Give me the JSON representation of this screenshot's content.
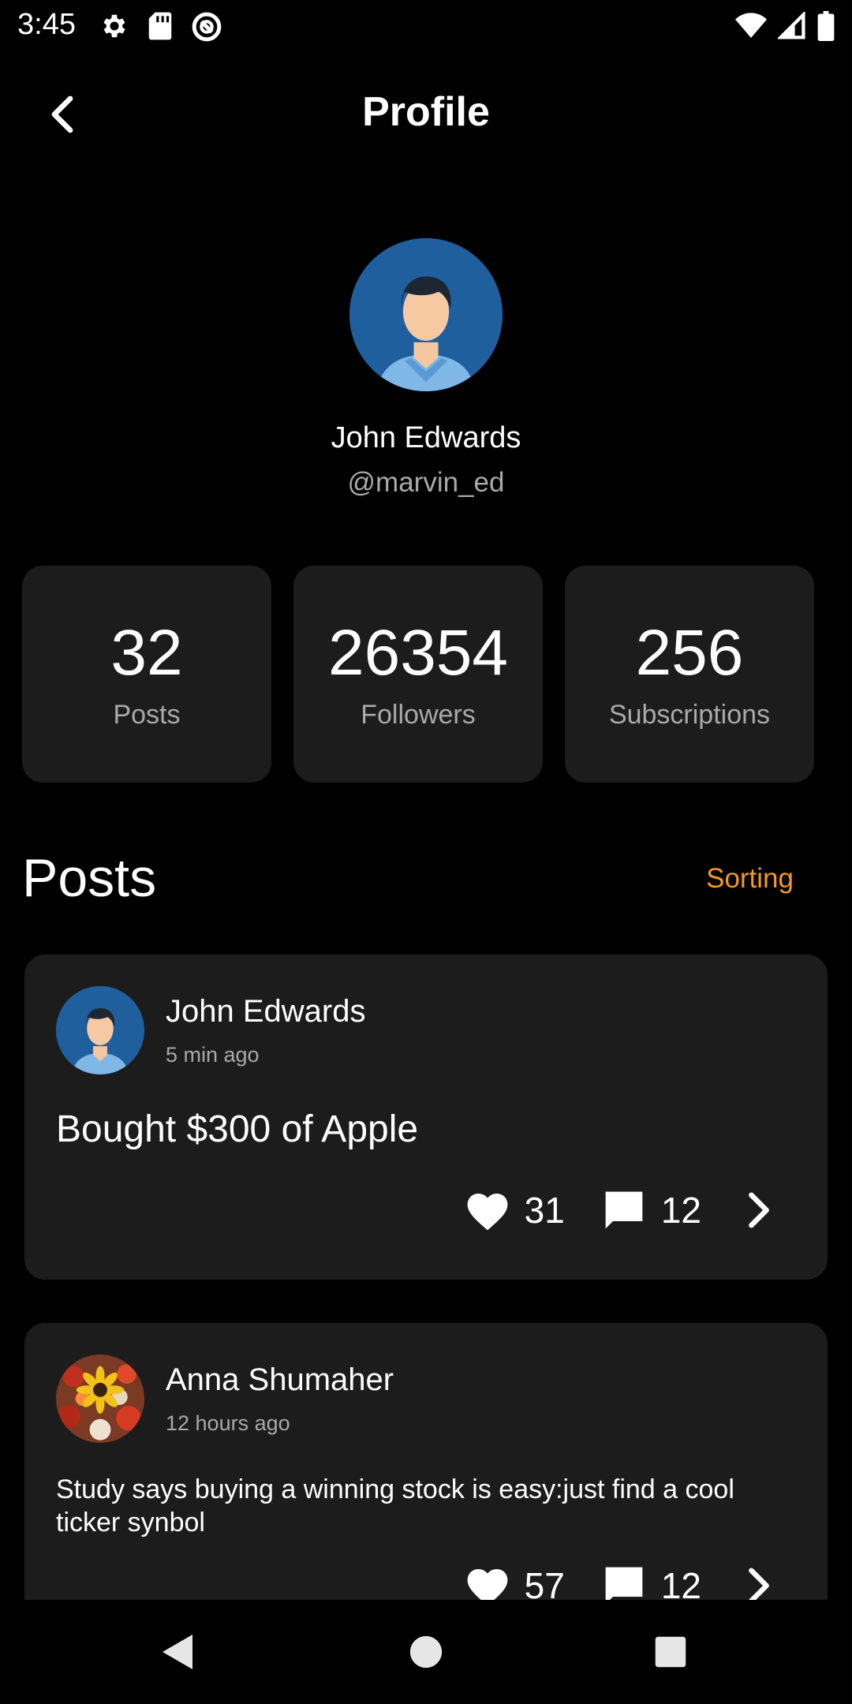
{
  "status_bar": {
    "time": "3:45",
    "left_icons": [
      "gear-icon",
      "sd-card-icon",
      "no-disturb-icon"
    ],
    "right_icons": [
      "wifi-icon",
      "cell-signal-icon",
      "battery-icon"
    ]
  },
  "header": {
    "title": "Profile",
    "back_icon": "chevron-left-icon"
  },
  "profile": {
    "name": "John Edwards",
    "handle": "@marvin_ed",
    "avatar": "male-avatar"
  },
  "stats": [
    {
      "value": "32",
      "label": "Posts"
    },
    {
      "value": "26354",
      "label": "Followers"
    },
    {
      "value": "256",
      "label": "Subscriptions"
    }
  ],
  "posts_section": {
    "title": "Posts",
    "sorting_label": "Sorting"
  },
  "posts": [
    {
      "author": "John Edwards",
      "time": "5 min ago",
      "text": "Bought $300 of Apple",
      "likes": "31",
      "comments": "12",
      "avatar": "male-avatar"
    },
    {
      "author": "Anna Shumaher",
      "time": "12 hours ago",
      "text": "Study says buying a winning stock is easy:just find a cool ticker synbol",
      "likes": "57",
      "comments": "12",
      "avatar": "flowers-avatar"
    }
  ],
  "colors": {
    "background": "#000000",
    "card": "#1c1c1c",
    "accent": "#f39a1d",
    "muted_text": "#a9a9a9"
  },
  "nav_bar": [
    "back-triangle-icon",
    "home-circle-icon",
    "recents-square-icon"
  ]
}
